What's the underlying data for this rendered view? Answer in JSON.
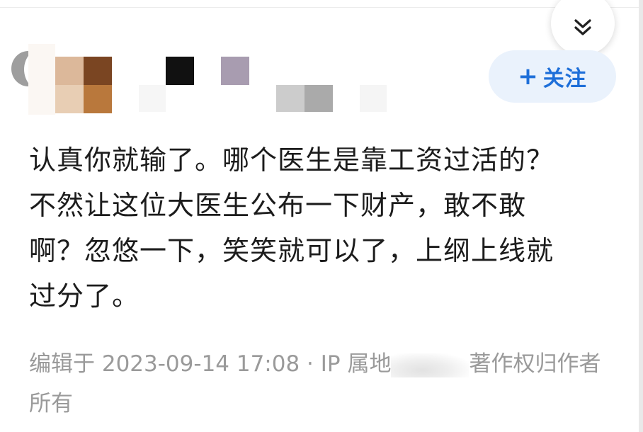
{
  "answer": {
    "follow_button": {
      "icon": "plus-icon",
      "label": "关注",
      "color": "#1e6fd9",
      "background": "#eaf2fc"
    },
    "content_lines": [
      "认真你就输了。哪个医生是靠工资过活的？",
      "不然让这位大医生公布一下财产，敢不敢",
      "啊？忽悠一下，笑笑就可以了，上纲上线就",
      "过分了。"
    ],
    "meta": {
      "edited_prefix": "编辑于 2023-09-14 17:08 · IP 属地",
      "copyright": "著作权归作者所有"
    }
  },
  "collapse_button": {
    "icon": "double-chevron-down-icon"
  }
}
